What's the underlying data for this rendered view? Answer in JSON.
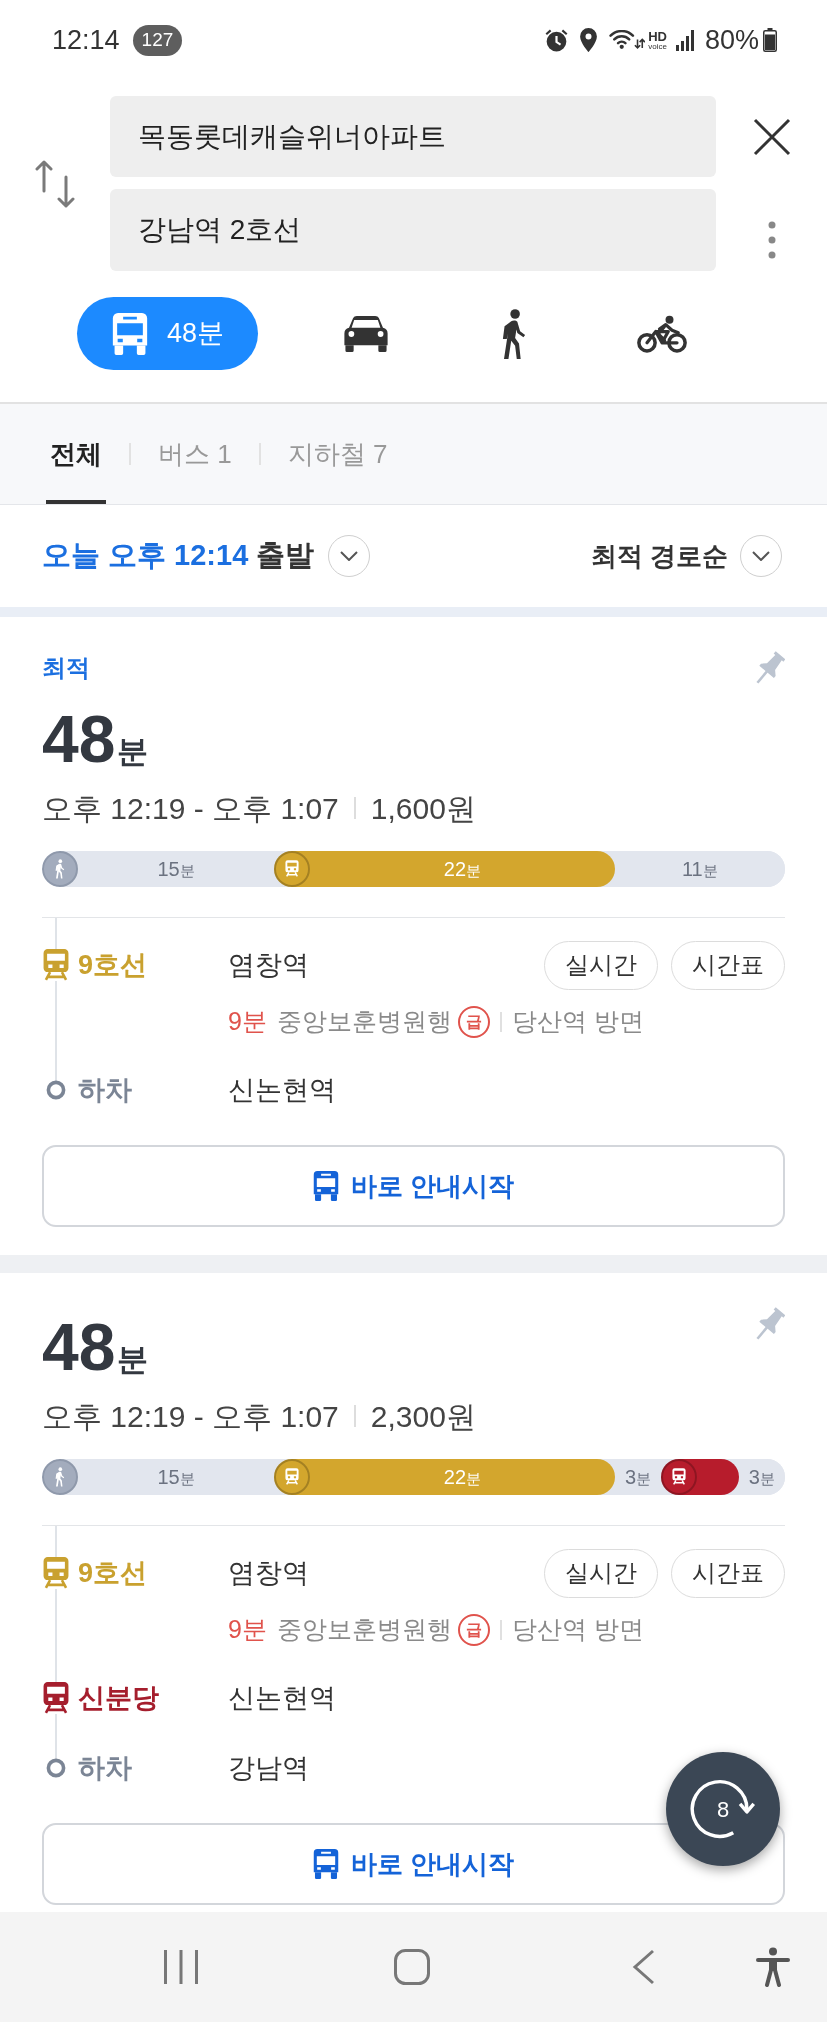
{
  "status_bar": {
    "time": "12:14",
    "notification_count": "127",
    "hd_label": "HD",
    "voice_label": "voice",
    "battery": "80%"
  },
  "search": {
    "origin": "목동롯데캐슬위너아파트",
    "destination": "강남역 2호선"
  },
  "modes": [
    {
      "kind": "bus",
      "selected": true,
      "label": "48분"
    },
    {
      "kind": "car",
      "selected": false
    },
    {
      "kind": "walk",
      "selected": false
    },
    {
      "kind": "bike",
      "selected": false
    }
  ],
  "tabs": [
    {
      "label": "전체",
      "selected": true
    },
    {
      "label": "버스 1",
      "selected": false
    },
    {
      "label": "지하철 7",
      "selected": false
    }
  ],
  "departure": {
    "time": "오늘 오후 12:14",
    "suffix": "출발"
  },
  "sort": {
    "label": "최적 경로순"
  },
  "routes": [
    {
      "badge": "최적",
      "duration": "48",
      "duration_unit": "분",
      "time_range": "오후 12:19 - 오후 1:07",
      "fare": "1,600원",
      "segments": [
        {
          "kind": "walk",
          "icon": true,
          "minutes": "15",
          "unit": "분"
        },
        {
          "kind": "subway",
          "icon": true,
          "color": "#d3a62d",
          "minutes": "22",
          "unit": "분"
        },
        {
          "kind": "walk",
          "icon": false,
          "minutes": "11",
          "unit": "분"
        }
      ],
      "steps": [
        {
          "kind": "board",
          "line": "9호선",
          "color": "#c9a12f",
          "station": "염창역",
          "buttons": [
            "실시간",
            "시간표"
          ],
          "arrival": "9분",
          "destination": "중앙보훈병원행",
          "express": "급",
          "direction": "당산역 방면"
        },
        {
          "kind": "alight",
          "line": "하차",
          "station": "신논현역"
        }
      ],
      "start_button": "바로 안내시작"
    },
    {
      "duration": "48",
      "duration_unit": "분",
      "time_range": "오후 12:19 - 오후 1:07",
      "fare": "2,300원",
      "segments": [
        {
          "kind": "walk",
          "icon": true,
          "minutes": "15",
          "unit": "분"
        },
        {
          "kind": "subway",
          "icon": true,
          "color": "#d3a62d",
          "minutes": "22",
          "unit": "분"
        },
        {
          "kind": "walk",
          "icon": false,
          "minutes": "3",
          "unit": "분"
        },
        {
          "kind": "subway",
          "icon": true,
          "color": "#b71c2c"
        },
        {
          "kind": "walk",
          "icon": false,
          "minutes": "3",
          "unit": "분"
        }
      ],
      "steps": [
        {
          "kind": "board",
          "line": "9호선",
          "color": "#c9a12f",
          "station": "염창역",
          "buttons": [
            "실시간",
            "시간표"
          ],
          "arrival": "9분",
          "destination": "중앙보훈병원행",
          "express": "급",
          "direction": "당산역 방면"
        },
        {
          "kind": "board",
          "line": "신분당",
          "color": "#a51e2d",
          "station": "신논현역"
        },
        {
          "kind": "alight",
          "line": "하차",
          "station": "강남역"
        }
      ],
      "start_button": "바로 안내시작"
    }
  ],
  "refresh_button": {
    "count": "8"
  }
}
